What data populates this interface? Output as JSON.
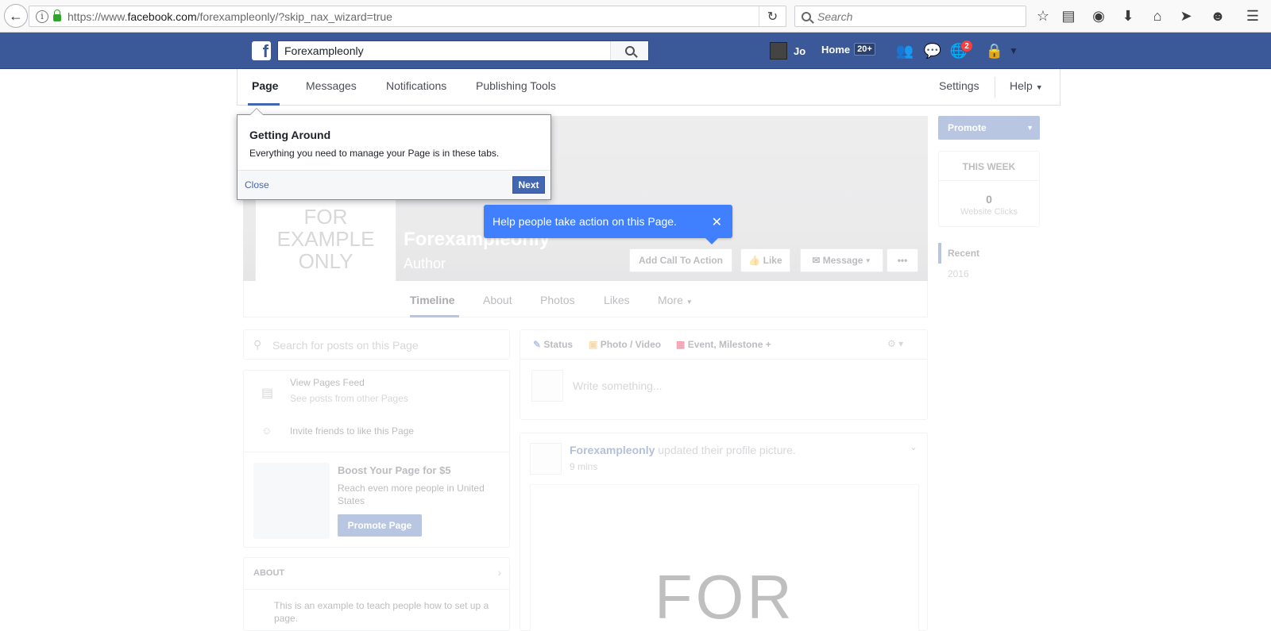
{
  "browser": {
    "url_prefix": "https://www.",
    "url_host": "facebook.com",
    "url_path": "/forexampleonly/?skip_nax_wizard=true",
    "search_placeholder": "Search"
  },
  "fb_header": {
    "search_value": "Forexampleonly",
    "user_name": "Jo",
    "home_label": "Home",
    "home_count": "20+",
    "notification_count": "2"
  },
  "page_tabs": {
    "page": "Page",
    "messages": "Messages",
    "notifications": "Notifications",
    "publishing_tools": "Publishing Tools",
    "settings": "Settings",
    "help": "Help"
  },
  "tour_popup": {
    "title": "Getting Around",
    "body": "Everything you need to manage your Page is in these tabs.",
    "close": "Close",
    "next": "Next"
  },
  "cta_tip": {
    "text": "Help people take action on this Page."
  },
  "cover": {
    "profile_lines": [
      "FOR",
      "EXAMPLE",
      "ONLY"
    ],
    "page_name": "Forexampleonly",
    "category": "Author",
    "add_cta": "Add Call To Action",
    "like": "Like",
    "message": "Message",
    "more_dots": "•••"
  },
  "sub_tabs": {
    "timeline": "Timeline",
    "about": "About",
    "photos": "Photos",
    "likes": "Likes",
    "more": "More"
  },
  "right_col": {
    "promote": "Promote",
    "this_week": "THIS WEEK",
    "clicks_value": "0",
    "clicks_label": "Website Clicks",
    "recent": "Recent",
    "year": "2016"
  },
  "left_col": {
    "search_placeholder": "Search for posts on this Page",
    "view_feed": "View Pages Feed",
    "view_feed_sub": "See posts from other Pages",
    "invite": "Invite friends to like this Page",
    "boost_title": "Boost Your Page for $5",
    "boost_body": "Reach even more people in United States",
    "promote_page": "Promote Page",
    "about_title": "ABOUT",
    "about_text": "This is an example to teach people how to set up a page."
  },
  "composer": {
    "status": "Status",
    "photo_video": "Photo / Video",
    "event": "Event, Milestone +",
    "placeholder": "Write something..."
  },
  "post": {
    "author": "Forexampleonly",
    "action": "updated their profile picture.",
    "time": "9 mins",
    "image_text": "FOR"
  }
}
